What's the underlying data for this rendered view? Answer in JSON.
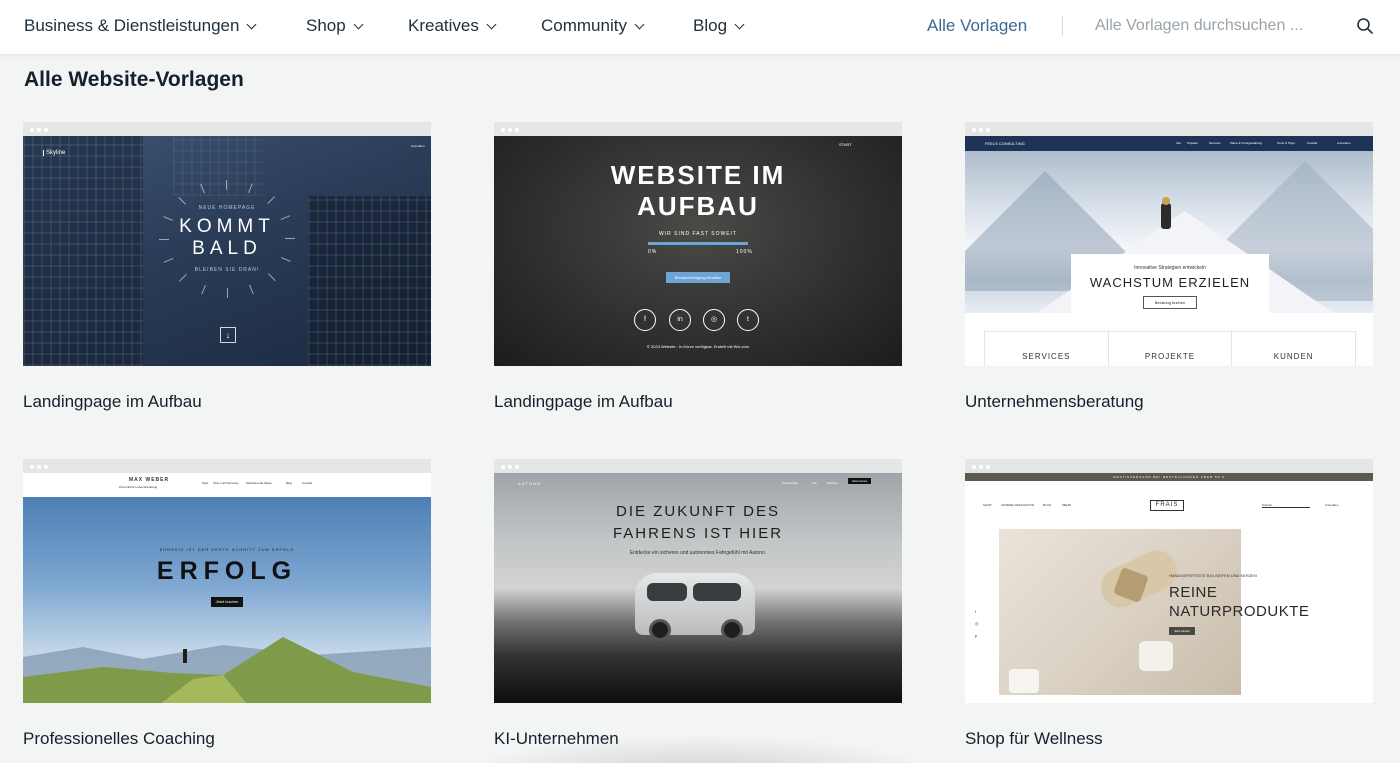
{
  "nav": {
    "items": [
      {
        "label": "Business & Dienstleistungen"
      },
      {
        "label": "Shop"
      },
      {
        "label": "Kreatives"
      },
      {
        "label": "Community"
      },
      {
        "label": "Blog"
      }
    ],
    "all_templates": "Alle Vorlagen",
    "search_placeholder": "Alle Vorlagen durchsuchen ...",
    "search_icon": "search-icon"
  },
  "page_title": "Alle Website-Vorlagen",
  "colors": {
    "background": "#f3f4f4",
    "link": "#3b6a94",
    "text": "#14202b"
  },
  "templates": [
    {
      "label": "Landingpage im Aufbau",
      "preview": {
        "logo": "Skyline",
        "kicker": "NEUE HOMEPAGE",
        "line1": "KOMMT",
        "line2": "BALD",
        "tagline": "BLEIBEN SIE DRAN!",
        "login": "Anmelden"
      }
    },
    {
      "label": "Landingpage im Aufbau",
      "preview": {
        "nav": "START",
        "line1": "WEBSITE IM",
        "line2": "AUFBAU",
        "sub": "WIR SIND FAST SOWEIT",
        "progress_start": "0%",
        "progress_end": "100%",
        "progress": 1.0,
        "button": "Benachrichtigung erhalten",
        "social": [
          "f",
          "in",
          "◎",
          "t"
        ],
        "footer": "© 2023 Website - In Kürze verfügbar. Erstellt mit Wix.com"
      }
    },
    {
      "label": "Unternehmensberatung",
      "preview": {
        "brand": "FEELS CONSULTING",
        "menu": [
          "Info",
          "Projekte",
          "Services",
          "Pläne & Preisgestaltung",
          "Tools & Tipps",
          "Kontakt"
        ],
        "login": "Anmelden",
        "kicker": "Innovative Strategien entwickeln",
        "headline": "WACHSTUM ERZIELEN",
        "button": "Beratung buchen",
        "tiles": [
          "SERVICES",
          "PROJEKTE",
          "KUNDEN"
        ]
      }
    },
    {
      "label": "Professionelles Coaching",
      "preview": {
        "brand": "MAX WEBER",
        "brand_sub": "Persönliche Lebensberatung",
        "menu": [
          "Start",
          "Über mich",
          "Services",
          "Motivierende Zitate",
          "Blog",
          "Kontakt"
        ],
        "kicker": "EHRGEIZ IST DER ERSTE SCHRITT ZUM ERFOLG",
        "headline": "ERFOLG",
        "button": "Jetzt buchen"
      }
    },
    {
      "label": "KI-Unternehmen",
      "preview": {
        "brand": "AUTONO",
        "menu": [
          "Technologie",
          "Info",
          "Karriere"
        ],
        "cta": "Abonnieren",
        "line1": "DIE ZUKUNFT DES",
        "line2": "FAHRENS IST HIER",
        "sub": "Entdecke ein sicheres und autonomes Fahrgefühl mit Autono."
      }
    },
    {
      "label": "Shop für Wellness",
      "preview": {
        "banner": "GRATISVERSAND BEI BESTELLUNGEN ÜBER 50 €",
        "menu": [
          "SHOP",
          "UNSERE GESCHICHTE",
          "BLOG",
          "MEHR"
        ],
        "logo": "FRAIS",
        "search": "Suchen ...",
        "login": "Anmelden",
        "kicker": "HANDGEFERTIGTE BIO-SEIFEN UND KERZEN",
        "line1": "REINE",
        "line2": "NATURPRODUKTE",
        "button": "Jetzt kaufen"
      }
    }
  ]
}
